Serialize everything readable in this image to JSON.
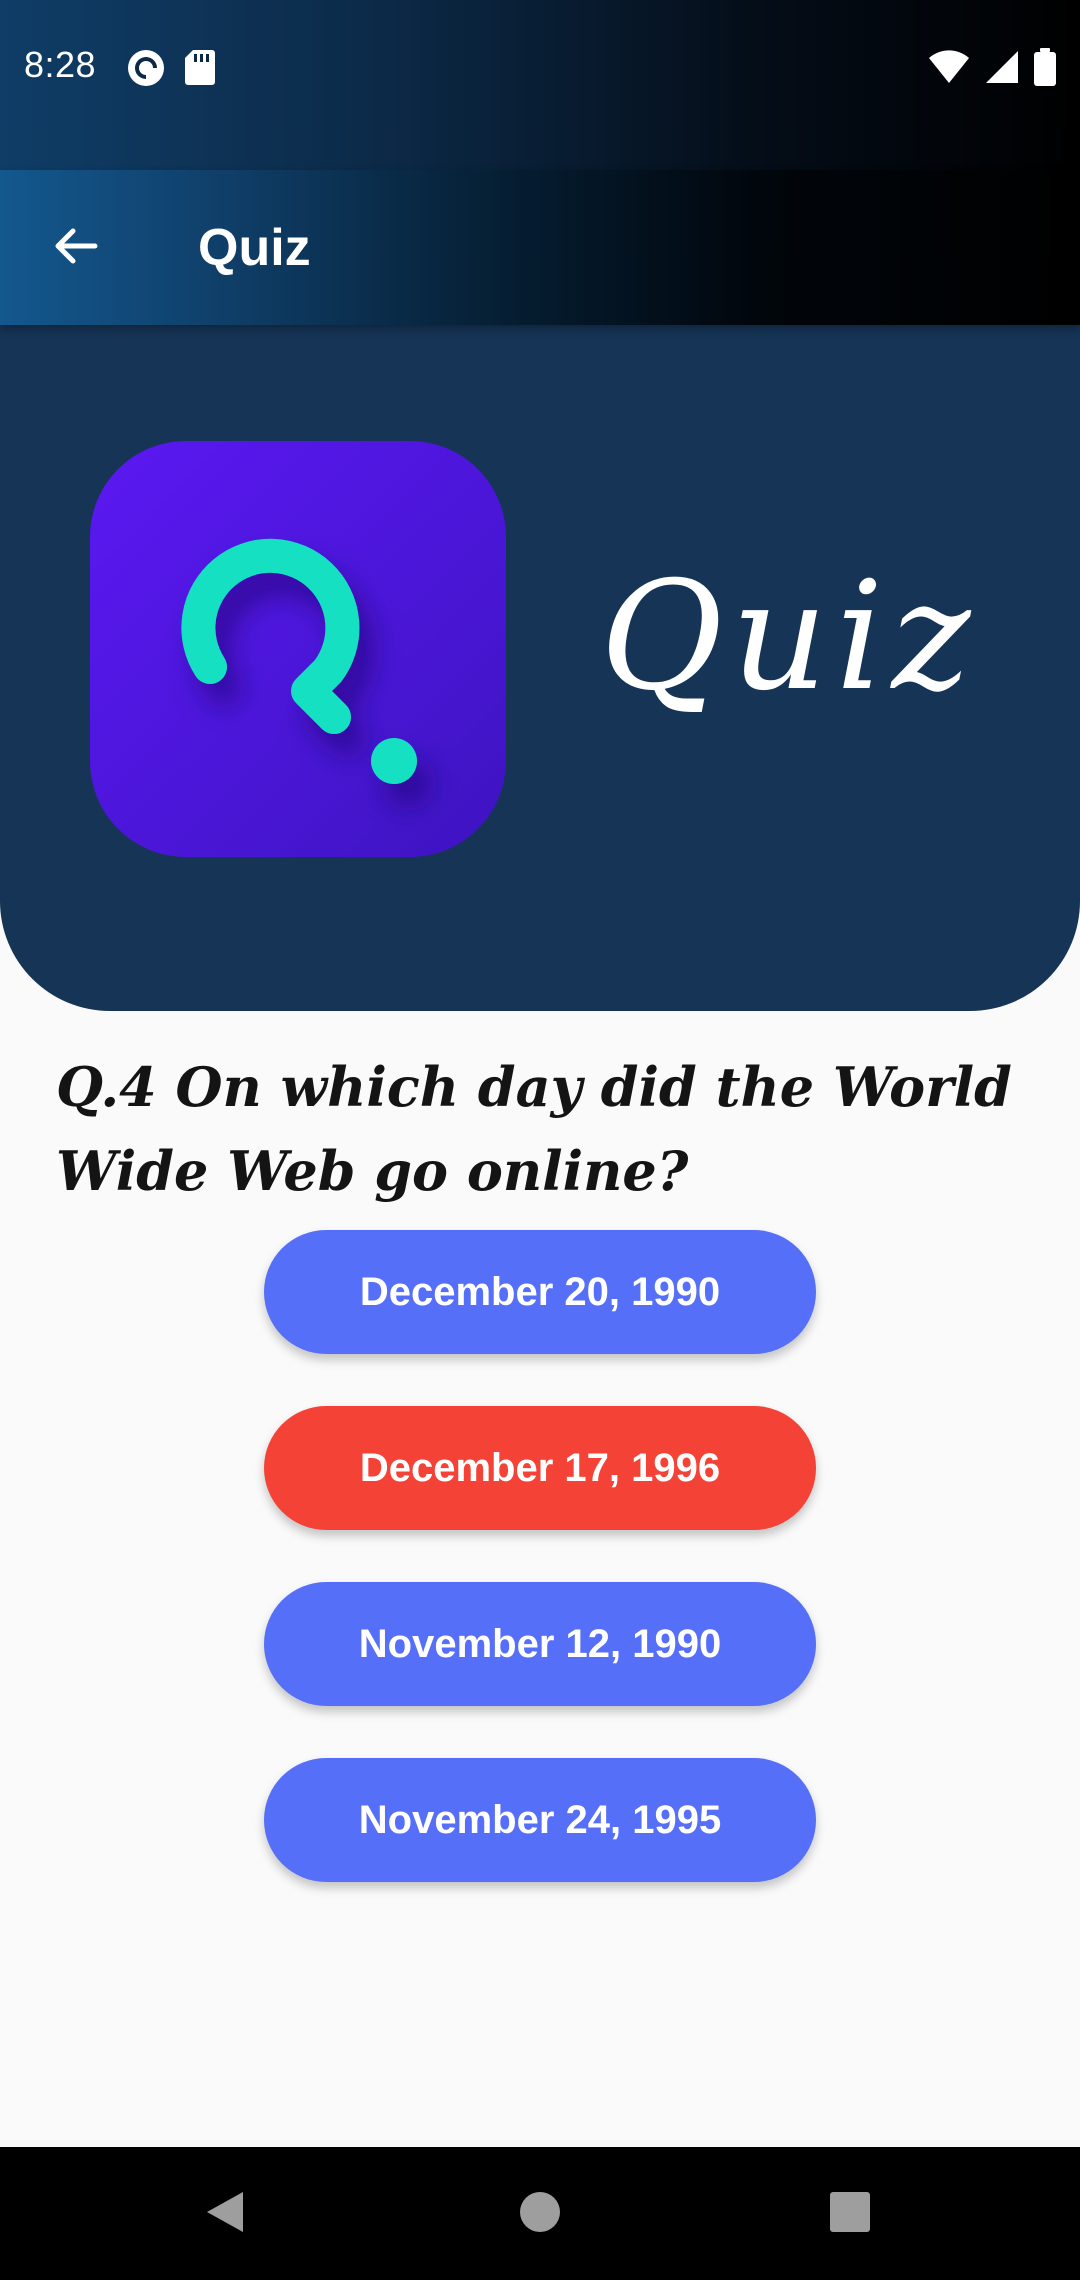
{
  "status_bar": {
    "time": "8:28",
    "left_icons": [
      "pocket-casts-icon",
      "sd-card-icon"
    ],
    "right_icons": [
      "wifi-icon",
      "cellular-signal-icon",
      "battery-icon"
    ]
  },
  "app_bar": {
    "back_icon": "arrow-back-icon",
    "title": "Quiz"
  },
  "header": {
    "logo_icon": "quiz-logo-icon",
    "brand_text": "Quiz"
  },
  "question": {
    "text": "Q.4 On which day did the World Wide Web go online?"
  },
  "answers": [
    {
      "label": "December 20, 1990",
      "color": "#566ff9"
    },
    {
      "label": "December 17, 1996",
      "color": "#f44336"
    },
    {
      "label": "November 12, 1990",
      "color": "#566ff9"
    },
    {
      "label": "November 24, 1995",
      "color": "#566ff9"
    }
  ],
  "colors": {
    "answer_default": "#566ff9",
    "answer_wrong": "#f44336",
    "header_bg": "#163456",
    "logo_accent": "#18e0c2",
    "logo_bg": "#5218ee"
  },
  "nav_bar": {
    "items": [
      "nav-back-icon",
      "nav-home-icon",
      "nav-recents-icon"
    ]
  }
}
